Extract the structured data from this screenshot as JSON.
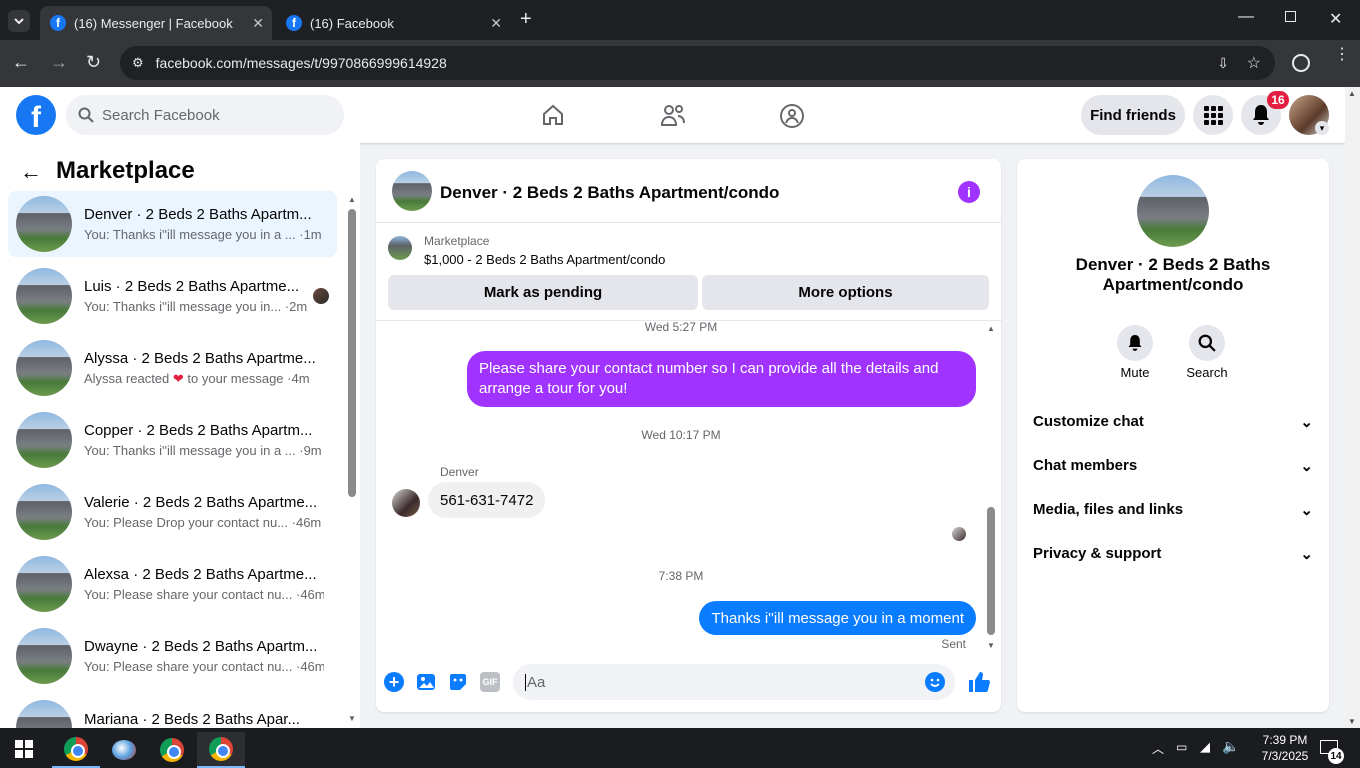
{
  "browser": {
    "tabs": [
      {
        "title": "(16) Messenger | Facebook",
        "active": true
      },
      {
        "title": "(16) Facebook",
        "active": false
      }
    ],
    "url": "facebook.com/messages/t/9970866999614928"
  },
  "fb_header": {
    "search_placeholder": "Search Facebook",
    "find_friends": "Find friends",
    "notif_count": "16"
  },
  "sidebar": {
    "title": "Marketplace",
    "items": [
      {
        "name": "Denver · 2 Beds 2 Baths Apartm...",
        "sub": "You: Thanks i''ill message you in a ... ·1m"
      },
      {
        "name": "Luis · 2 Beds 2 Baths Apartme...",
        "sub": "You: Thanks i''ill message you in... ·2m"
      },
      {
        "name": "Alyssa · 2 Beds 2 Baths Apartme...",
        "sub_pre": "Alyssa reacted",
        "sub_post": "to your message ·4m"
      },
      {
        "name": "Copper · 2 Beds 2 Baths Apartm...",
        "sub": "You: Thanks i''ill message you in a ... ·9m"
      },
      {
        "name": "Valerie · 2 Beds 2 Baths Apartme...",
        "sub": "You: Please Drop your contact nu... ·46m"
      },
      {
        "name": "Alexsa · 2 Beds 2 Baths Apartme...",
        "sub": "You: Please share your contact nu... ·46m"
      },
      {
        "name": "Dwayne · 2 Beds 2 Baths Apartm...",
        "sub": "You: Please share your contact nu... ·46m"
      },
      {
        "name": "Mariana · 2 Beds 2 Baths Apar...",
        "sub": ""
      }
    ]
  },
  "chat": {
    "title": "Denver · 2 Beds 2 Baths Apartment/condo",
    "listing_label": "Marketplace",
    "listing_price": "$1,000 - 2 Beds 2 Baths Apartment/condo",
    "mark_pending": "Mark as pending",
    "more_options": "More options",
    "ts1": "Wed 5:27 PM",
    "msg1": "Please share your contact number so I can provide all the details and arrange a tour for you!",
    "ts2": "Wed 10:17 PM",
    "sender": "Denver",
    "msg2": "561-631-7472",
    "ts3": "7:38 PM",
    "msg3": "Thanks i''ill message you in a moment",
    "sent": "Sent",
    "composer_placeholder": "Aa",
    "gif": "GIF"
  },
  "details": {
    "title": "Denver · 2 Beds 2 Baths Apartment/condo",
    "mute": "Mute",
    "search": "Search",
    "sections": [
      "Customize chat",
      "Chat members",
      "Media, files and links",
      "Privacy & support"
    ]
  },
  "taskbar": {
    "time": "7:39 PM",
    "date": "7/3/2025",
    "notif": "14"
  },
  "colors": {
    "accent": "#a033ff",
    "outgoing_blue": "#0a7cff",
    "fb_blue": "#1877f2"
  }
}
